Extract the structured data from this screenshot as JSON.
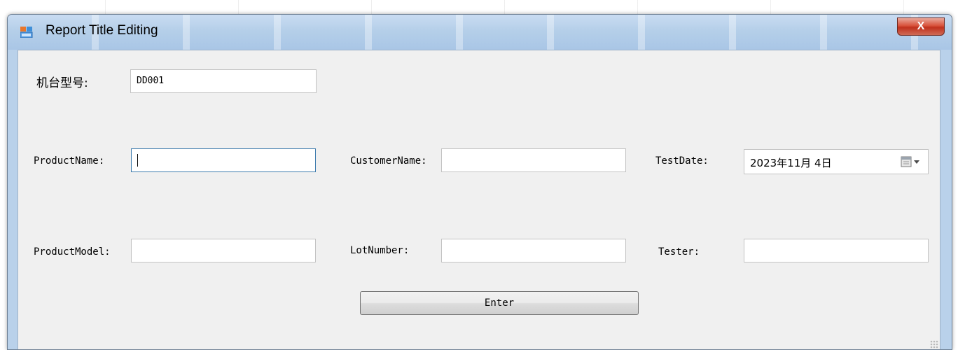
{
  "window": {
    "title": "Report Title Editing",
    "close_glyph": "X"
  },
  "form": {
    "machine_model_label": "机台型号:",
    "machine_model_value": "DD001",
    "product_name_label": "ProductName:",
    "product_name_value": "",
    "customer_name_label": "CustomerName:",
    "customer_name_value": "",
    "test_date_label": "TestDate:",
    "test_date_value": "2023年11月 4日",
    "product_model_label": "ProductModel:",
    "product_model_value": "",
    "lot_number_label": "LotNumber:",
    "lot_number_value": "",
    "tester_label": "Tester:",
    "tester_value": ""
  },
  "buttons": {
    "enter_label": "Enter"
  },
  "icons": {
    "app": "app-window-icon",
    "calendar": "calendar-dropdown-icon",
    "close": "close-icon"
  },
  "colors": {
    "titlebar": "#b5cfe9",
    "client_bg": "#f0f0f0",
    "close_red": "#c0311d",
    "focus_border": "#3d7bad"
  }
}
